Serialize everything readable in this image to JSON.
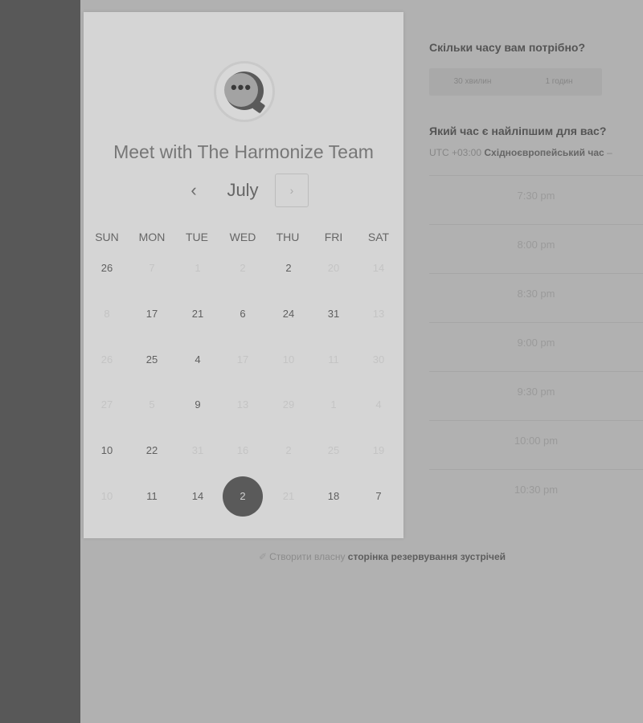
{
  "card": {
    "title": "Meet with The Harmonize Team",
    "logo_dots": "•••",
    "month": "July",
    "prev_glyph": "‹",
    "next_glyph": "›"
  },
  "weekdays": [
    "SUN",
    "MON",
    "TUE",
    "WED",
    "THU",
    "FRI",
    "SAT"
  ],
  "calendar": {
    "selected_day": "2",
    "weeks": [
      [
        {
          "d": "26",
          "a": true
        },
        {
          "d": "7",
          "a": false
        },
        {
          "d": "1",
          "a": false
        },
        {
          "d": "2",
          "a": false
        },
        {
          "d": "2",
          "a": true
        },
        {
          "d": "20",
          "a": false
        },
        {
          "d": "14",
          "a": false
        }
      ],
      [
        {
          "d": "8",
          "a": false
        },
        {
          "d": "17",
          "a": true
        },
        {
          "d": "21",
          "a": true
        },
        {
          "d": "6",
          "a": true
        },
        {
          "d": "24",
          "a": true
        },
        {
          "d": "31",
          "a": true
        },
        {
          "d": "13",
          "a": false
        }
      ],
      [
        {
          "d": "26",
          "a": false
        },
        {
          "d": "25",
          "a": true
        },
        {
          "d": "4",
          "a": true
        },
        {
          "d": "17",
          "a": false
        },
        {
          "d": "10",
          "a": false
        },
        {
          "d": "11",
          "a": false
        },
        {
          "d": "30",
          "a": false
        }
      ],
      [
        {
          "d": "27",
          "a": false
        },
        {
          "d": "5",
          "a": false
        },
        {
          "d": "9",
          "a": true
        },
        {
          "d": "13",
          "a": false
        },
        {
          "d": "29",
          "a": false
        },
        {
          "d": "1",
          "a": false
        },
        {
          "d": "4",
          "a": false
        }
      ],
      [
        {
          "d": "10",
          "a": true
        },
        {
          "d": "22",
          "a": true
        },
        {
          "d": "31",
          "a": false
        },
        {
          "d": "16",
          "a": false
        },
        {
          "d": "2",
          "a": false
        },
        {
          "d": "25",
          "a": false
        },
        {
          "d": "19",
          "a": false
        }
      ],
      [
        {
          "d": "10",
          "a": false
        },
        {
          "d": "11",
          "a": true
        },
        {
          "d": "14",
          "a": true
        },
        {
          "d": "2",
          "a": true,
          "sel": true
        },
        {
          "d": "21",
          "a": false
        },
        {
          "d": "18",
          "a": true
        },
        {
          "d": "7",
          "a": true
        }
      ]
    ]
  },
  "duration": {
    "question": "Скільки часу вам потрібно?",
    "options": [
      "30 хвилин",
      "1 годин"
    ]
  },
  "timeslots": {
    "question": "Який час є найліпшим для вас?",
    "tz_offset": "UTC +03:00",
    "tz_name": "Східноєвропейський час",
    "tz_arrow": "–",
    "slots": [
      "7:30 pm",
      "8:00 pm",
      "8:30 pm",
      "9:00 pm",
      "9:30 pm",
      "10:00 pm",
      "10:30 pm"
    ]
  },
  "footer": {
    "icon": "✐",
    "prefix": "Створити власну",
    "link": "сторінка резервування зустрічей"
  },
  "colors": {
    "left_bar": "#585858",
    "background": "#b1b1b1",
    "card": "#d5d5d5",
    "selected_day": "#5a5a5a"
  }
}
